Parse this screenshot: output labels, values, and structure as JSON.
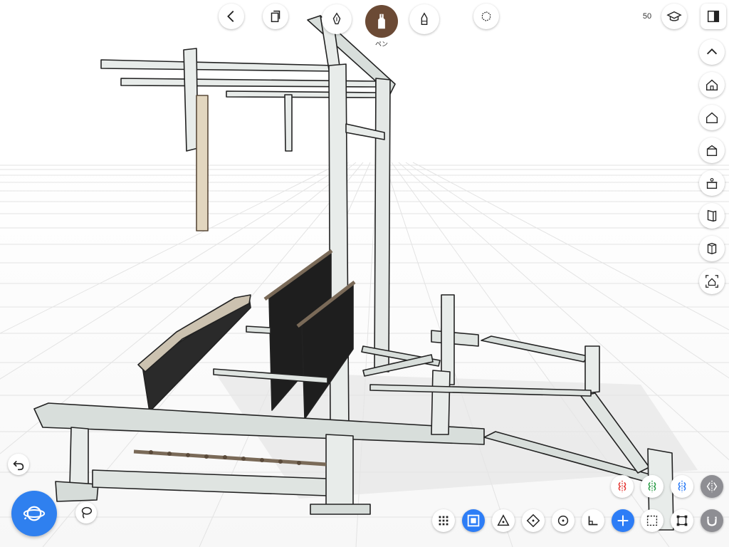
{
  "toolbar": {
    "pen_label": "ペン",
    "zoom_value": "50"
  },
  "icons": {
    "back": "chevron-left-icon",
    "copy": "copy-icon",
    "fountain_pen": "fountain-pen-icon",
    "pen": "pen-icon",
    "marker": "marker-icon",
    "view_cube": "view-cube-icon",
    "learn": "graduation-cap-icon",
    "panel": "side-panel-icon",
    "collapse": "chevron-up-icon",
    "home_views": [
      "home-icon",
      "house-outline-icon",
      "box-icon",
      "bowl-icon",
      "book-icon",
      "cube-icon",
      "framed-house-icon"
    ],
    "undo": "undo-icon",
    "navigate": "orbit-navigation-icon",
    "lasso": "lasso-icon",
    "mirror": [
      "mirror-red-icon",
      "mirror-green-icon",
      "mirror-blue-icon",
      "mirror-grey-icon"
    ],
    "snap": [
      "grid-snap-icon",
      "face-snap-icon",
      "triangle-snap-icon",
      "diamond-snap-icon",
      "circle-snap-icon",
      "angle-snap-icon",
      "plus-snap-icon",
      "selection-snap-icon",
      "corner-snap-icon",
      "magnet-icon"
    ]
  },
  "colors": {
    "accent": "#2d7df6",
    "pen_active": "#6b4a35",
    "mirror_red": "#e53935",
    "mirror_green": "#2e9e4a",
    "mirror_blue": "#2d7df6"
  }
}
